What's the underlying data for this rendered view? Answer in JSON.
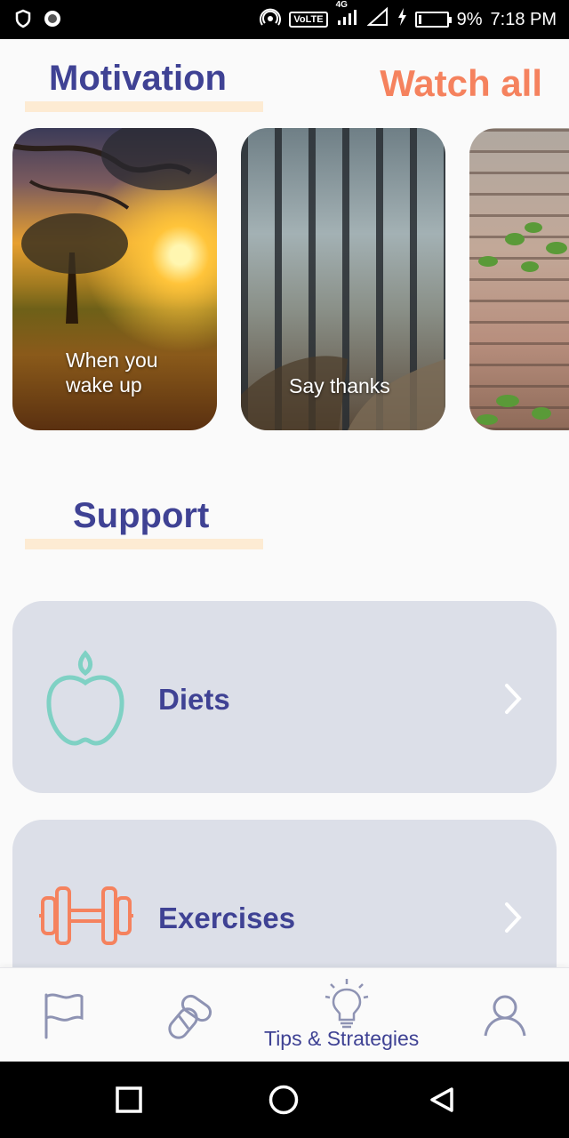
{
  "status_bar": {
    "network_badge": "VoLTE",
    "signal_type": "4G",
    "battery_percent": "9%",
    "battery_level": 0.09,
    "time": "7:18 PM",
    "icons": [
      "shield-icon",
      "record-icon",
      "hotspot-icon",
      "volte-icon",
      "signal-icon",
      "wifi-signal-icon",
      "charging-icon",
      "battery-icon"
    ]
  },
  "motivation": {
    "title": "Motivation",
    "watch_all_label": "Watch all",
    "cards": [
      {
        "line1": "When you",
        "line2": "wake up"
      },
      {
        "line1": "Say thanks",
        "line2": ""
      },
      {
        "line1": "",
        "line2": ""
      }
    ]
  },
  "support": {
    "title": "Support",
    "items": [
      {
        "label": "Diets",
        "icon": "apple-icon",
        "icon_color": "#7fd1c4"
      },
      {
        "label": "Exercises",
        "icon": "dumbbell-icon",
        "icon_color": "#f5825e"
      }
    ]
  },
  "bottom_nav": {
    "items": [
      {
        "icon": "flag-icon",
        "label": ""
      },
      {
        "icon": "pills-icon",
        "label": ""
      },
      {
        "icon": "lightbulb-icon",
        "label": "Tips & Strategies",
        "active": true
      },
      {
        "icon": "profile-icon",
        "label": ""
      }
    ]
  },
  "colors": {
    "primary": "#3f4294",
    "accent": "#f5825e",
    "underline": "#fdebd3",
    "card_bg": "#dcdfe8",
    "nav_icon": "#8e93b3"
  }
}
